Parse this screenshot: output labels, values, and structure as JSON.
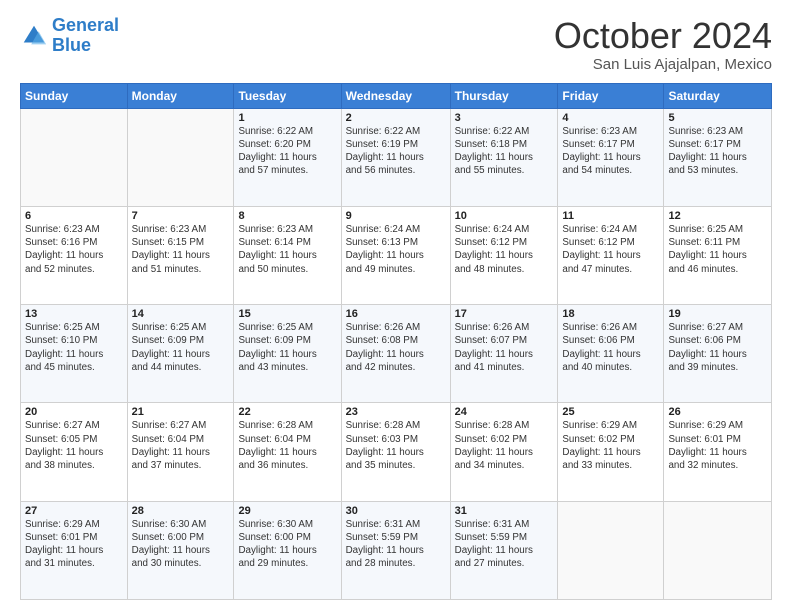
{
  "header": {
    "logo_line1": "General",
    "logo_line2": "Blue",
    "month_title": "October 2024",
    "location": "San Luis Ajajalpan, Mexico"
  },
  "weekdays": [
    "Sunday",
    "Monday",
    "Tuesday",
    "Wednesday",
    "Thursday",
    "Friday",
    "Saturday"
  ],
  "weeks": [
    [
      {
        "day": "",
        "info": ""
      },
      {
        "day": "",
        "info": ""
      },
      {
        "day": "1",
        "info": "Sunrise: 6:22 AM\nSunset: 6:20 PM\nDaylight: 11 hours\nand 57 minutes."
      },
      {
        "day": "2",
        "info": "Sunrise: 6:22 AM\nSunset: 6:19 PM\nDaylight: 11 hours\nand 56 minutes."
      },
      {
        "day": "3",
        "info": "Sunrise: 6:22 AM\nSunset: 6:18 PM\nDaylight: 11 hours\nand 55 minutes."
      },
      {
        "day": "4",
        "info": "Sunrise: 6:23 AM\nSunset: 6:17 PM\nDaylight: 11 hours\nand 54 minutes."
      },
      {
        "day": "5",
        "info": "Sunrise: 6:23 AM\nSunset: 6:17 PM\nDaylight: 11 hours\nand 53 minutes."
      }
    ],
    [
      {
        "day": "6",
        "info": "Sunrise: 6:23 AM\nSunset: 6:16 PM\nDaylight: 11 hours\nand 52 minutes."
      },
      {
        "day": "7",
        "info": "Sunrise: 6:23 AM\nSunset: 6:15 PM\nDaylight: 11 hours\nand 51 minutes."
      },
      {
        "day": "8",
        "info": "Sunrise: 6:23 AM\nSunset: 6:14 PM\nDaylight: 11 hours\nand 50 minutes."
      },
      {
        "day": "9",
        "info": "Sunrise: 6:24 AM\nSunset: 6:13 PM\nDaylight: 11 hours\nand 49 minutes."
      },
      {
        "day": "10",
        "info": "Sunrise: 6:24 AM\nSunset: 6:12 PM\nDaylight: 11 hours\nand 48 minutes."
      },
      {
        "day": "11",
        "info": "Sunrise: 6:24 AM\nSunset: 6:12 PM\nDaylight: 11 hours\nand 47 minutes."
      },
      {
        "day": "12",
        "info": "Sunrise: 6:25 AM\nSunset: 6:11 PM\nDaylight: 11 hours\nand 46 minutes."
      }
    ],
    [
      {
        "day": "13",
        "info": "Sunrise: 6:25 AM\nSunset: 6:10 PM\nDaylight: 11 hours\nand 45 minutes."
      },
      {
        "day": "14",
        "info": "Sunrise: 6:25 AM\nSunset: 6:09 PM\nDaylight: 11 hours\nand 44 minutes."
      },
      {
        "day": "15",
        "info": "Sunrise: 6:25 AM\nSunset: 6:09 PM\nDaylight: 11 hours\nand 43 minutes."
      },
      {
        "day": "16",
        "info": "Sunrise: 6:26 AM\nSunset: 6:08 PM\nDaylight: 11 hours\nand 42 minutes."
      },
      {
        "day": "17",
        "info": "Sunrise: 6:26 AM\nSunset: 6:07 PM\nDaylight: 11 hours\nand 41 minutes."
      },
      {
        "day": "18",
        "info": "Sunrise: 6:26 AM\nSunset: 6:06 PM\nDaylight: 11 hours\nand 40 minutes."
      },
      {
        "day": "19",
        "info": "Sunrise: 6:27 AM\nSunset: 6:06 PM\nDaylight: 11 hours\nand 39 minutes."
      }
    ],
    [
      {
        "day": "20",
        "info": "Sunrise: 6:27 AM\nSunset: 6:05 PM\nDaylight: 11 hours\nand 38 minutes."
      },
      {
        "day": "21",
        "info": "Sunrise: 6:27 AM\nSunset: 6:04 PM\nDaylight: 11 hours\nand 37 minutes."
      },
      {
        "day": "22",
        "info": "Sunrise: 6:28 AM\nSunset: 6:04 PM\nDaylight: 11 hours\nand 36 minutes."
      },
      {
        "day": "23",
        "info": "Sunrise: 6:28 AM\nSunset: 6:03 PM\nDaylight: 11 hours\nand 35 minutes."
      },
      {
        "day": "24",
        "info": "Sunrise: 6:28 AM\nSunset: 6:02 PM\nDaylight: 11 hours\nand 34 minutes."
      },
      {
        "day": "25",
        "info": "Sunrise: 6:29 AM\nSunset: 6:02 PM\nDaylight: 11 hours\nand 33 minutes."
      },
      {
        "day": "26",
        "info": "Sunrise: 6:29 AM\nSunset: 6:01 PM\nDaylight: 11 hours\nand 32 minutes."
      }
    ],
    [
      {
        "day": "27",
        "info": "Sunrise: 6:29 AM\nSunset: 6:01 PM\nDaylight: 11 hours\nand 31 minutes."
      },
      {
        "day": "28",
        "info": "Sunrise: 6:30 AM\nSunset: 6:00 PM\nDaylight: 11 hours\nand 30 minutes."
      },
      {
        "day": "29",
        "info": "Sunrise: 6:30 AM\nSunset: 6:00 PM\nDaylight: 11 hours\nand 29 minutes."
      },
      {
        "day": "30",
        "info": "Sunrise: 6:31 AM\nSunset: 5:59 PM\nDaylight: 11 hours\nand 28 minutes."
      },
      {
        "day": "31",
        "info": "Sunrise: 6:31 AM\nSunset: 5:59 PM\nDaylight: 11 hours\nand 27 minutes."
      },
      {
        "day": "",
        "info": ""
      },
      {
        "day": "",
        "info": ""
      }
    ]
  ]
}
